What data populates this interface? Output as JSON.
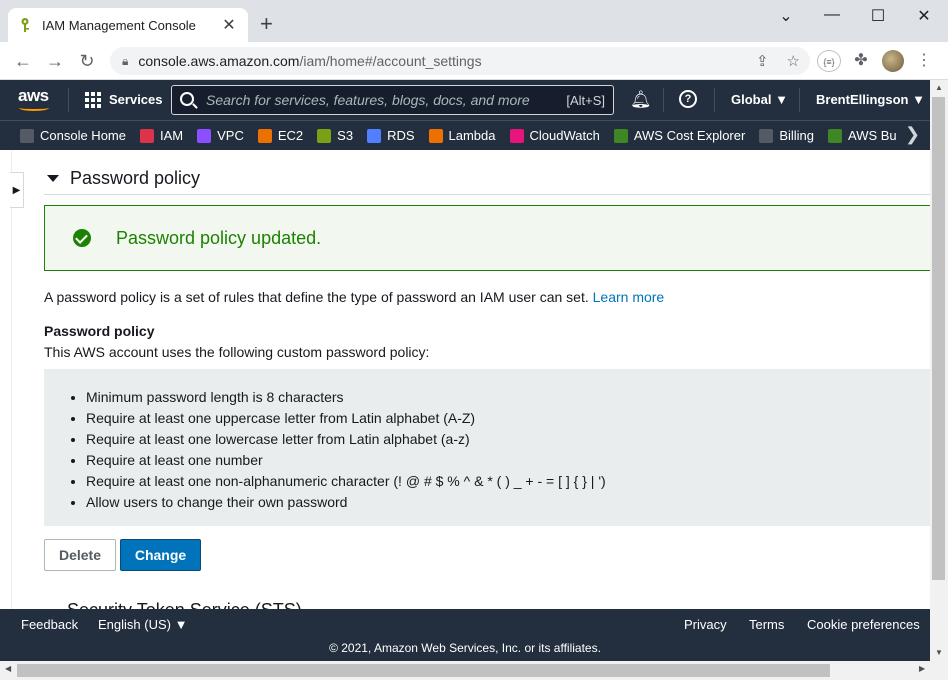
{
  "browser": {
    "tab_title": "IAM Management Console",
    "url_host": "console.aws.amazon.com",
    "url_path": "/iam/home#/account_settings",
    "extension_label": "{≡}"
  },
  "aws_nav": {
    "logo": "aws",
    "services_label": "Services",
    "search_placeholder": "Search for services, features, blogs, docs, and more",
    "search_shortcut": "[Alt+S]",
    "region": "Global",
    "user": "BrentEllingson"
  },
  "favorites": [
    {
      "label": "Console Home",
      "icon": "console-home-icon",
      "color": "#545b64"
    },
    {
      "label": "IAM",
      "icon": "iam-icon",
      "color": "#dd344c"
    },
    {
      "label": "VPC",
      "icon": "vpc-icon",
      "color": "#8c4fff"
    },
    {
      "label": "EC2",
      "icon": "ec2-icon",
      "color": "#ed7100"
    },
    {
      "label": "S3",
      "icon": "s3-icon",
      "color": "#7aa116"
    },
    {
      "label": "RDS",
      "icon": "rds-icon",
      "color": "#527fff"
    },
    {
      "label": "Lambda",
      "icon": "lambda-icon",
      "color": "#ed7100"
    },
    {
      "label": "CloudWatch",
      "icon": "cloudwatch-icon",
      "color": "#e7157b"
    },
    {
      "label": "AWS Cost Explorer",
      "icon": "cost-explorer-icon",
      "color": "#3f8624"
    },
    {
      "label": "Billing",
      "icon": "billing-icon",
      "color": "#545b64"
    },
    {
      "label": "AWS Bu",
      "icon": "budgets-icon",
      "color": "#3f8624"
    }
  ],
  "main": {
    "section_title": "Password policy",
    "flash_message": "Password policy updated.",
    "description": "A password policy is a set of rules that define the type of password an IAM user can set.",
    "learn_more": "Learn more",
    "policy_heading": "Password policy",
    "policy_subtitle": "This AWS account uses the following custom password policy:",
    "rules": [
      "Minimum password length is 8 characters",
      "Require at least one uppercase letter from Latin alphabet (A-Z)",
      "Require at least one lowercase letter from Latin alphabet (a-z)",
      "Require at least one number",
      "Require at least one non-alphanumeric character (! @ # $ % ^ & * ( ) _ + - = [ ] { } | ')",
      "Allow users to change their own password"
    ],
    "delete_label": "Delete",
    "change_label": "Change",
    "next_section_title": "Security Token Service (STS)"
  },
  "footer": {
    "feedback": "Feedback",
    "language": "English (US)",
    "privacy": "Privacy",
    "terms": "Terms",
    "cookie": "Cookie preferences",
    "copyright": "© 2021, Amazon Web Services, Inc. or its affiliates."
  },
  "colors": {
    "aws_navy": "#232f3e",
    "aws_orange": "#ff9900",
    "success_green": "#1d8102",
    "link_blue": "#0073bb"
  }
}
